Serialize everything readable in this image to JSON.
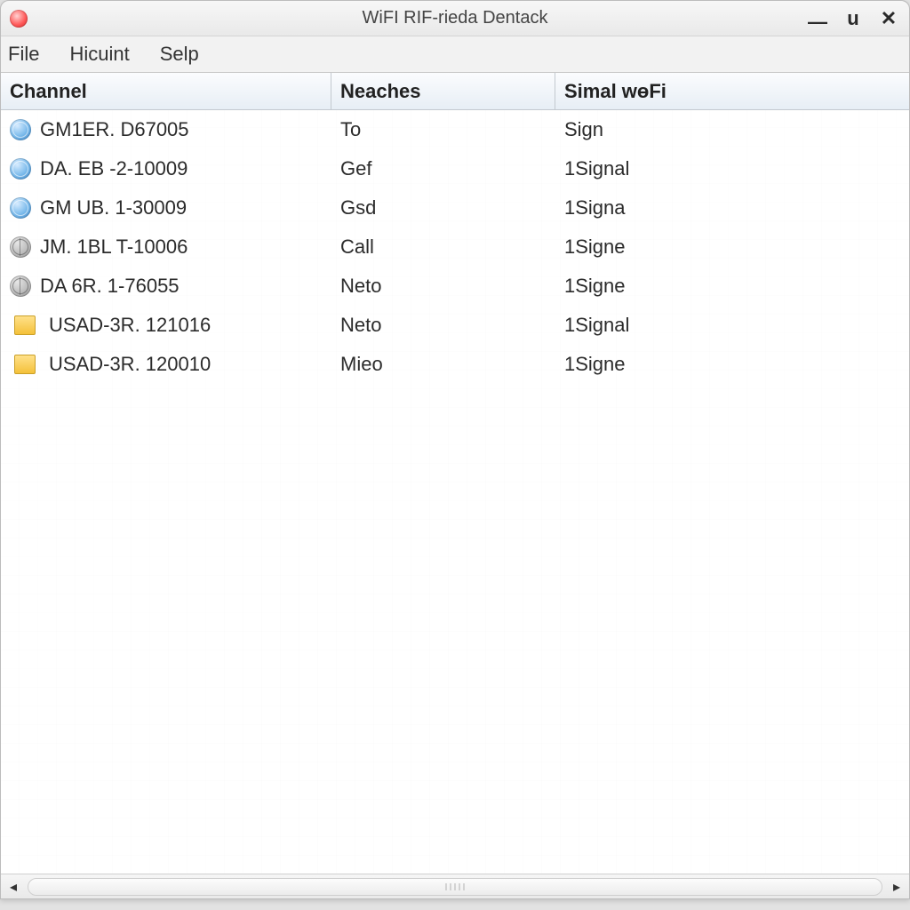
{
  "window": {
    "title": "WiFI RIF-rieda Dentack"
  },
  "menus": {
    "file": "File",
    "hicuint": "Hicuint",
    "selp": "Selp"
  },
  "columns": {
    "channel": "Channel",
    "neaches": "Neaches",
    "simal": "Simal wɵFi"
  },
  "rows": [
    {
      "icon": "globe",
      "channel": "GM1ER. D67005",
      "neaches": "To",
      "simal": "Sign"
    },
    {
      "icon": "globe",
      "channel": "DA. EB -2-10009",
      "neaches": "Gef",
      "simal": "1Signal"
    },
    {
      "icon": "globe",
      "channel": "GM UB. 1-30009",
      "neaches": "Gsd",
      "simal": "1Signa"
    },
    {
      "icon": "net",
      "channel": "JM. 1BL T-10006",
      "neaches": "Call",
      "simal": "1Signe"
    },
    {
      "icon": "net",
      "channel": "DA 6R. 1-76055",
      "neaches": "Neto",
      "simal": "1Signe"
    },
    {
      "icon": "folder",
      "channel": "USAD-3R. 121016",
      "neaches": "Neto",
      "simal": "1Signal"
    },
    {
      "icon": "folder",
      "channel": "USAD-3R. 120010",
      "neaches": "Mieo",
      "simal": "1Signe"
    }
  ]
}
